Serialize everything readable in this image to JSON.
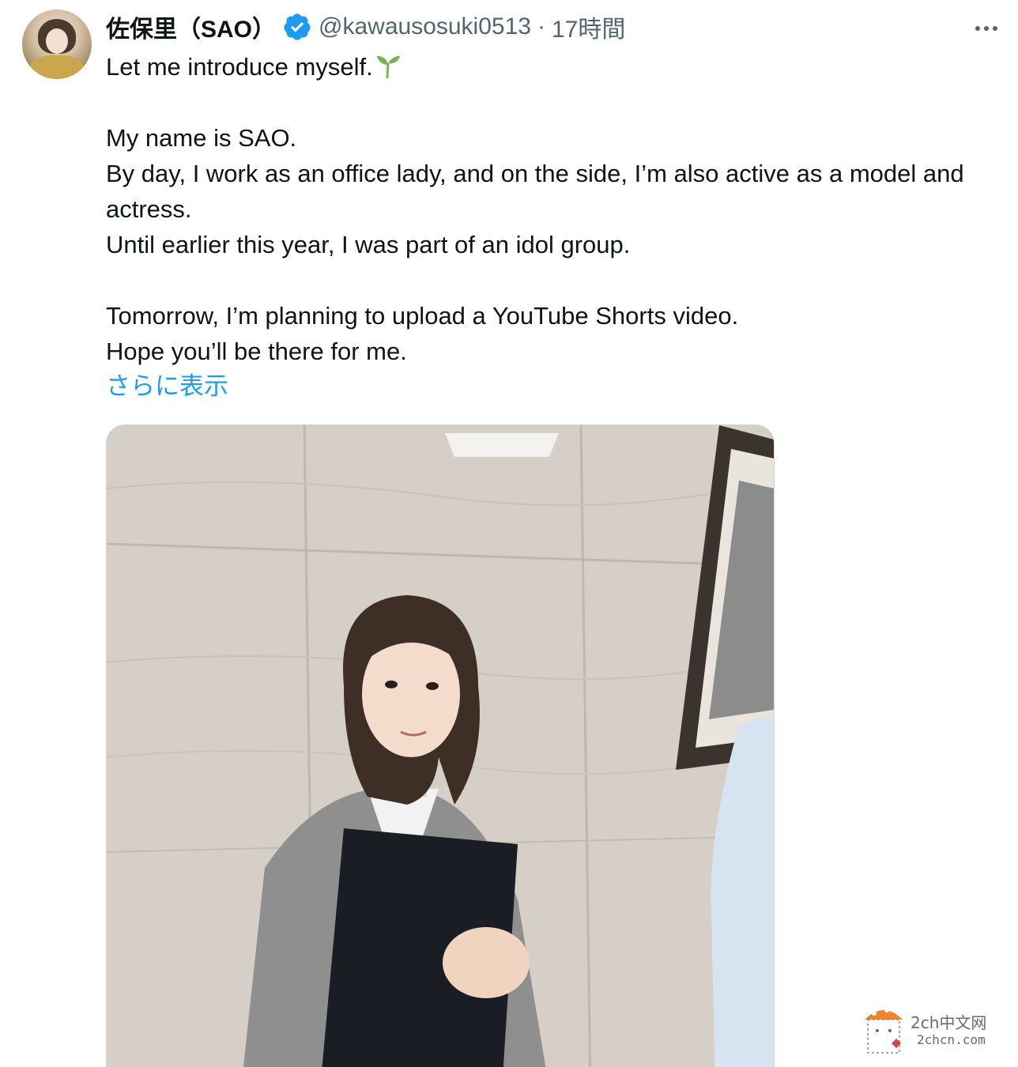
{
  "tweet": {
    "display_name": "佐保里（SAO）",
    "handle": "@kawausosuki0513",
    "separator": "·",
    "time": "17時間",
    "verified": true,
    "more_icon": "more-horizontal-icon",
    "paragraphs": [
      "Let me introduce myself.",
      "",
      "My name is SAO.",
      "By day, I work as an office lady, and on the side, I’m also active as a model and actress.",
      "Until earlier this year, I was part of an idol group.",
      "",
      "Tomorrow, I’m planning to upload a YouTube Shorts video.",
      "Hope you’ll be there for me."
    ],
    "emoji": "seedling-icon",
    "show_more": "さらに表示"
  },
  "watermark": {
    "line1": "2ch中文网",
    "line2": "2chcn.com"
  },
  "colors": {
    "link": "#1d9bf0",
    "secondary_text": "#536471",
    "verified_badge": "#1d9bf0"
  }
}
